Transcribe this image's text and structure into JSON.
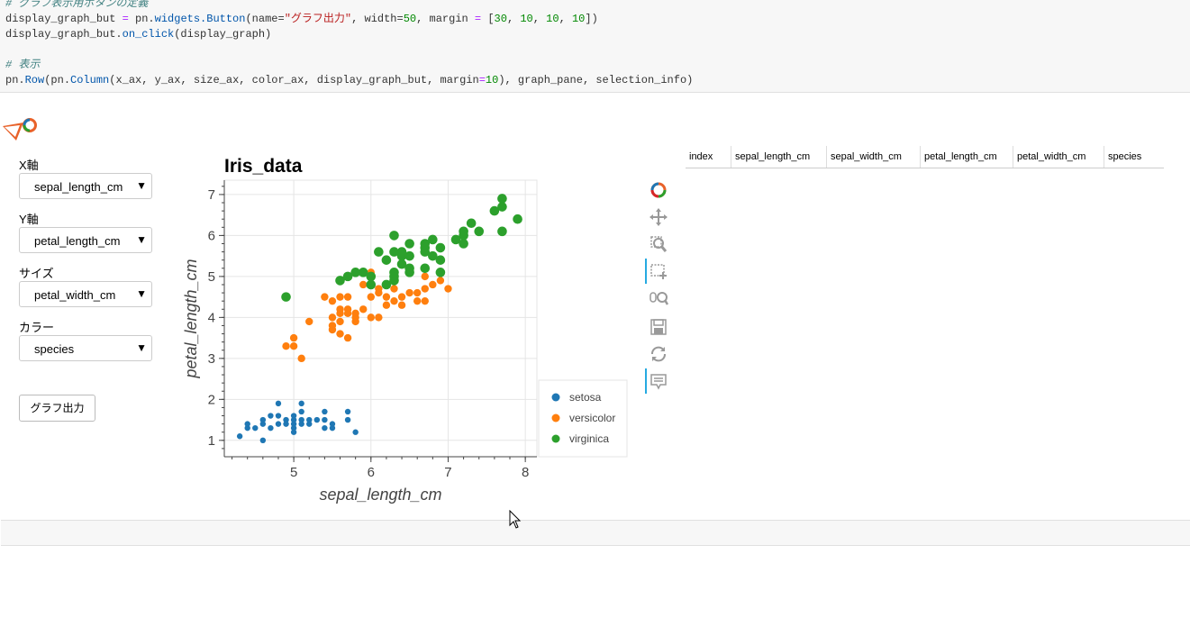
{
  "code": {
    "line1_comment": "# グラフ表示用ボタンの定義",
    "line2": {
      "a": "display_graph_but ",
      "eq": "=",
      "b": " pn.",
      "fn": "widgets.Button",
      "c": "(name=",
      "s": "\"グラフ出力\"",
      "d": ", width=",
      "n1": "50",
      "e": ", margin ",
      "eq2": "=",
      "f": " [",
      "n2": "30",
      "g": ", ",
      "n3": "10",
      "h": ", ",
      "n4": "10",
      "i": ", ",
      "n5": "10",
      "j": "])"
    },
    "line3": {
      "a": "display_graph_but.",
      "fn": "on_click",
      "b": "(display_graph)"
    },
    "line4_comment": "# 表示",
    "line5": {
      "a": "pn.",
      "fn1": "Row",
      "b": "(pn.",
      "fn2": "Column",
      "c": "(x_ax, y_ax, size_ax, color_ax, display_graph_but, margin",
      "eq": "=",
      "n": "10",
      "d": "), graph_pane, selection_info)"
    }
  },
  "controls": {
    "x_label": "X軸",
    "x_value": "sepal_length_cm",
    "y_label": "Y軸",
    "y_value": "petal_length_cm",
    "size_label": "サイズ",
    "size_value": "petal_width_cm",
    "color_label": "カラー",
    "color_value": "species",
    "caret": "▼",
    "button_label": "グラフ出力"
  },
  "chart_data": {
    "type": "scatter",
    "title": "Iris_data",
    "xlabel": "sepal_length_cm",
    "ylabel": "petal_length_cm",
    "xlim": [
      4.1,
      8.15
    ],
    "ylim": [
      0.6,
      7.35
    ],
    "xticks": [
      5,
      6,
      7,
      8
    ],
    "yticks": [
      1,
      2,
      3,
      4,
      5,
      6,
      7
    ],
    "grid": true,
    "legend_position": "right",
    "series": [
      {
        "name": "setosa",
        "color": "#1f77b4",
        "size": 3.2,
        "points": [
          [
            4.3,
            1.1
          ],
          [
            4.4,
            1.3
          ],
          [
            4.4,
            1.4
          ],
          [
            4.5,
            1.3
          ],
          [
            4.6,
            1.0
          ],
          [
            4.6,
            1.4
          ],
          [
            4.6,
            1.5
          ],
          [
            4.7,
            1.3
          ],
          [
            4.7,
            1.6
          ],
          [
            4.8,
            1.4
          ],
          [
            4.8,
            1.6
          ],
          [
            4.8,
            1.9
          ],
          [
            4.9,
            1.4
          ],
          [
            4.9,
            1.5
          ],
          [
            5.0,
            1.2
          ],
          [
            5.0,
            1.3
          ],
          [
            5.0,
            1.4
          ],
          [
            5.0,
            1.5
          ],
          [
            5.0,
            1.6
          ],
          [
            5.1,
            1.4
          ],
          [
            5.1,
            1.5
          ],
          [
            5.1,
            1.7
          ],
          [
            5.1,
            1.9
          ],
          [
            5.2,
            1.4
          ],
          [
            5.2,
            1.5
          ],
          [
            5.3,
            1.5
          ],
          [
            5.4,
            1.3
          ],
          [
            5.4,
            1.5
          ],
          [
            5.4,
            1.7
          ],
          [
            5.5,
            1.3
          ],
          [
            5.5,
            1.4
          ],
          [
            5.7,
            1.5
          ],
          [
            5.7,
            1.7
          ],
          [
            5.8,
            1.2
          ]
        ]
      },
      {
        "name": "versicolor",
        "color": "#ff7f0e",
        "size": 4.2,
        "points": [
          [
            4.9,
            3.3
          ],
          [
            5.0,
            3.3
          ],
          [
            5.0,
            3.5
          ],
          [
            5.1,
            3.0
          ],
          [
            5.2,
            3.9
          ],
          [
            5.4,
            4.5
          ],
          [
            5.5,
            3.7
          ],
          [
            5.5,
            3.8
          ],
          [
            5.5,
            4.0
          ],
          [
            5.5,
            4.4
          ],
          [
            5.6,
            3.6
          ],
          [
            5.6,
            3.9
          ],
          [
            5.6,
            4.1
          ],
          [
            5.6,
            4.2
          ],
          [
            5.6,
            4.5
          ],
          [
            5.7,
            3.5
          ],
          [
            5.7,
            4.1
          ],
          [
            5.7,
            4.2
          ],
          [
            5.7,
            4.5
          ],
          [
            5.8,
            3.9
          ],
          [
            5.8,
            4.0
          ],
          [
            5.8,
            4.1
          ],
          [
            5.9,
            4.2
          ],
          [
            5.9,
            4.8
          ],
          [
            6.0,
            4.0
          ],
          [
            6.0,
            4.5
          ],
          [
            6.0,
            5.1
          ],
          [
            6.1,
            4.0
          ],
          [
            6.1,
            4.6
          ],
          [
            6.1,
            4.7
          ],
          [
            6.2,
            4.3
          ],
          [
            6.2,
            4.5
          ],
          [
            6.3,
            4.4
          ],
          [
            6.3,
            4.7
          ],
          [
            6.3,
            4.9
          ],
          [
            6.4,
            4.3
          ],
          [
            6.4,
            4.5
          ],
          [
            6.5,
            4.6
          ],
          [
            6.6,
            4.4
          ],
          [
            6.6,
            4.6
          ],
          [
            6.7,
            4.4
          ],
          [
            6.7,
            4.7
          ],
          [
            6.7,
            5.0
          ],
          [
            6.8,
            4.8
          ],
          [
            6.9,
            4.9
          ],
          [
            7.0,
            4.7
          ]
        ]
      },
      {
        "name": "virginica",
        "color": "#2ca02c",
        "size": 5.3,
        "points": [
          [
            4.9,
            4.5
          ],
          [
            5.6,
            4.9
          ],
          [
            5.7,
            5.0
          ],
          [
            5.8,
            5.1
          ],
          [
            5.9,
            5.1
          ],
          [
            6.0,
            4.8
          ],
          [
            6.0,
            5.0
          ],
          [
            6.1,
            5.6
          ],
          [
            6.2,
            4.8
          ],
          [
            6.2,
            5.4
          ],
          [
            6.3,
            4.9
          ],
          [
            6.3,
            5.0
          ],
          [
            6.3,
            5.1
          ],
          [
            6.3,
            5.6
          ],
          [
            6.3,
            6.0
          ],
          [
            6.4,
            5.3
          ],
          [
            6.4,
            5.5
          ],
          [
            6.4,
            5.6
          ],
          [
            6.5,
            5.1
          ],
          [
            6.5,
            5.2
          ],
          [
            6.5,
            5.5
          ],
          [
            6.5,
            5.8
          ],
          [
            6.7,
            5.2
          ],
          [
            6.7,
            5.6
          ],
          [
            6.7,
            5.7
          ],
          [
            6.7,
            5.8
          ],
          [
            6.8,
            5.5
          ],
          [
            6.8,
            5.9
          ],
          [
            6.9,
            5.1
          ],
          [
            6.9,
            5.4
          ],
          [
            6.9,
            5.7
          ],
          [
            7.1,
            5.9
          ],
          [
            7.2,
            5.8
          ],
          [
            7.2,
            6.0
          ],
          [
            7.2,
            6.1
          ],
          [
            7.3,
            6.3
          ],
          [
            7.4,
            6.1
          ],
          [
            7.6,
            6.6
          ],
          [
            7.7,
            6.1
          ],
          [
            7.7,
            6.7
          ],
          [
            7.7,
            6.9
          ],
          [
            7.9,
            6.4
          ]
        ]
      }
    ]
  },
  "toolbar": {
    "tools": [
      "bokeh-logo-icon",
      "pan-icon",
      "zoom-icon",
      "box-select-icon",
      "wheel-zoom-icon",
      "save-icon",
      "reset-icon",
      "hover-icon"
    ]
  },
  "table": {
    "columns": [
      "index",
      "sepal_length_cm",
      "sepal_width_cm",
      "petal_length_cm",
      "petal_width_cm",
      "species"
    ]
  }
}
